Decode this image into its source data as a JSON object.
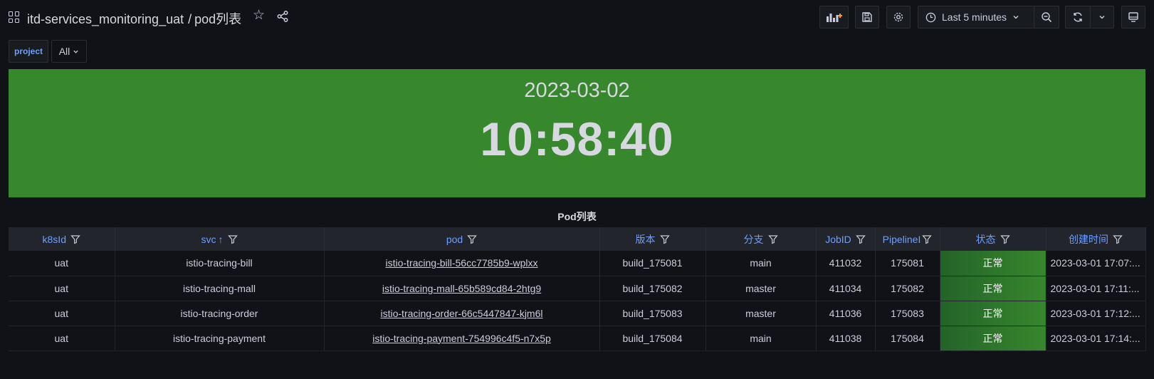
{
  "breadcrumb": {
    "folder": "itd-services_monitoring_uat",
    "separator": "/",
    "dashboard": "pod列表"
  },
  "toolbar": {
    "time_range_label": "Last 5 minutes"
  },
  "variables": {
    "project_label": "project",
    "project_value": "All"
  },
  "clock": {
    "date": "2023-03-02",
    "time": "10:58:40",
    "background_color": "#37872d"
  },
  "table": {
    "title": "Pod列表",
    "columns": [
      "k8sId",
      "svc",
      "pod",
      "版本",
      "分支",
      "JobID",
      "PipelineI",
      "状态",
      "创建时间"
    ],
    "sort_indicator": "↑",
    "rows": [
      {
        "k8sId": "uat",
        "svc": "istio-tracing-bill",
        "pod": "istio-tracing-bill-56cc7785b9-wplxx",
        "version": "build_175081",
        "branch": "main",
        "jobId": "411032",
        "pipeline": "175081",
        "status": "正常",
        "created": "2023-03-01 17:07:..."
      },
      {
        "k8sId": "uat",
        "svc": "istio-tracing-mall",
        "pod": "istio-tracing-mall-65b589cd84-2htg9",
        "version": "build_175082",
        "branch": "master",
        "jobId": "411034",
        "pipeline": "175082",
        "status": "正常",
        "created": "2023-03-01 17:11:..."
      },
      {
        "k8sId": "uat",
        "svc": "istio-tracing-order",
        "pod": "istio-tracing-order-66c5447847-kjm6l",
        "version": "build_175083",
        "branch": "master",
        "jobId": "411036",
        "pipeline": "175083",
        "status": "正常",
        "created": "2023-03-01 17:12:..."
      },
      {
        "k8sId": "uat",
        "svc": "istio-tracing-payment",
        "pod": "istio-tracing-payment-754996c4f5-n7x5p",
        "version": "build_175084",
        "branch": "main",
        "jobId": "411038",
        "pipeline": "175084",
        "status": "正常",
        "created": "2023-03-01 17:14:..."
      }
    ]
  }
}
